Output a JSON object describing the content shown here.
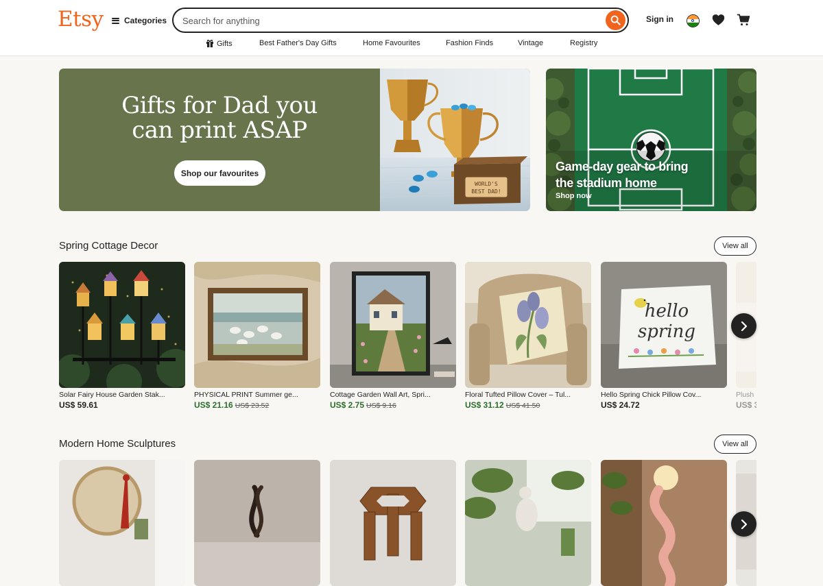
{
  "header": {
    "logo": "Etsy",
    "categories_label": "Categories",
    "search_placeholder": "Search for anything",
    "sign_in": "Sign in"
  },
  "nav": {
    "items": [
      "Gifts",
      "Best Father's Day Gifts",
      "Home Favourites",
      "Fashion Finds",
      "Vintage",
      "Registry"
    ]
  },
  "hero": {
    "left": {
      "title_line1": "Gifts for Dad you",
      "title_line2": "can print ASAP",
      "button": "Shop our favourites",
      "trophy_text_line1": "WORLD'S",
      "trophy_text_line2": "BEST DAD!"
    },
    "right": {
      "title_line1": "Game-day gear to bring",
      "title_line2": "the stadium home",
      "link": "Shop now"
    }
  },
  "sections": [
    {
      "title": "Spring Cottage Decor",
      "view_all": "View all",
      "items": [
        {
          "title": "Solar Fairy House Garden Stak...",
          "price": "US$ 59.61",
          "original_price": ""
        },
        {
          "title": "PHYSICAL PRINT Summer ge...",
          "price": "US$ 21.16",
          "original_price": "US$ 23.52"
        },
        {
          "title": "Cottage Garden Wall Art, Spri...",
          "price": "US$ 2.75",
          "original_price": "US$ 9.16"
        },
        {
          "title": "Floral Tufted Pillow Cover – Tul...",
          "price": "US$ 31.12",
          "original_price": "US$ 41.50"
        },
        {
          "title": "Hello Spring Chick Pillow Cov...",
          "price": "US$ 24.72",
          "original_price": ""
        },
        {
          "title": "Plush",
          "price": "US$ 3",
          "original_price": ""
        }
      ],
      "pillow_text_line1": "hello",
      "pillow_text_line2": "spring"
    },
    {
      "title": "Modern Home Sculptures",
      "view_all": "View all"
    }
  ],
  "colors": {
    "brand": "#f1641e",
    "hero_green": "#67744c",
    "sale_green": "#2a6f2a"
  },
  "icons": [
    "hamburger-icon",
    "search-icon",
    "india-flag-icon",
    "heart-icon",
    "cart-icon",
    "gift-icon",
    "chevron-right-icon"
  ]
}
